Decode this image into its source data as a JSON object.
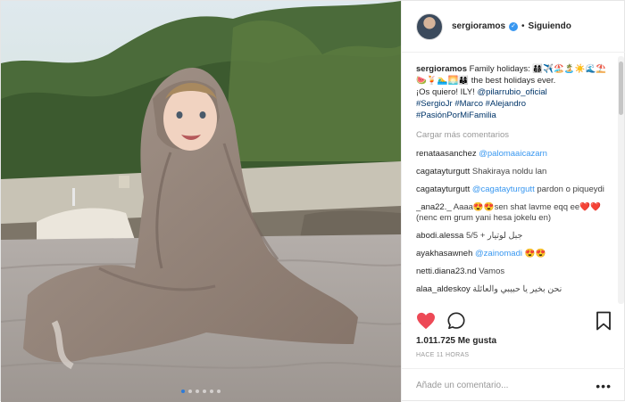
{
  "header": {
    "username": "sergioramos",
    "separator": "•",
    "follow_status": "Siguiendo"
  },
  "caption": {
    "username": "sergioramos",
    "text1": "Family holidays: 👨‍👩‍👦‍👦✈️🏖️🏝️☀️🌊⛱️🍉🍹🏊‍♂️🌅👨‍👩‍👦 the best holidays ever.",
    "text2": "¡Os quiero! ILY!",
    "mention": "@pilarrubio_oficial",
    "hashtags": [
      "#SergioJr",
      "#Marco",
      "#Alejandro",
      "#PasiónPorMiFamilia"
    ]
  },
  "load_more": "Cargar más comentarios",
  "comments": [
    {
      "user": "renataasanchez",
      "text": "",
      "mention": "@palomaaicazarn"
    },
    {
      "user": "cagatayturgutt",
      "text": "Shakiraya noldu lan",
      "mention": ""
    },
    {
      "user": "cagatayturgutt",
      "text": "pardon o piqueydi",
      "mention": "@cagatayturgutt"
    },
    {
      "user": "_ana22._",
      "text": "Aaaa😍😍sen shat lavme eqq ee❤️❤️ (nenc em grum yani hesa jokelu en)",
      "mention": ""
    },
    {
      "user": "abodi.alessa",
      "text": "5/5 + جبل لوتيار",
      "mention": ""
    },
    {
      "user": "ayakhasawneh",
      "text": "😍😍",
      "mention": "@zainomadi"
    },
    {
      "user": "netti.diana23.nd",
      "text": "Vamos",
      "mention": ""
    },
    {
      "user": "alaa_aldeskoy",
      "text": "نحن بخير يا حبيبي والعائلة",
      "mention": ""
    }
  ],
  "likes": "1.011.725 Me gusta",
  "timestamp": "HACE 11 HORAS",
  "add_comment": {
    "placeholder": "Añade un comentario..."
  },
  "more_options": "•••",
  "colors": {
    "like_red": "#ed4956",
    "link_blue": "#3897f0",
    "verified_blue": "#3897f0"
  },
  "icons": [
    "heart-icon",
    "comment-icon",
    "bookmark-icon",
    "verified-icon"
  ],
  "carousel": {
    "slides": 6,
    "active": 1
  }
}
